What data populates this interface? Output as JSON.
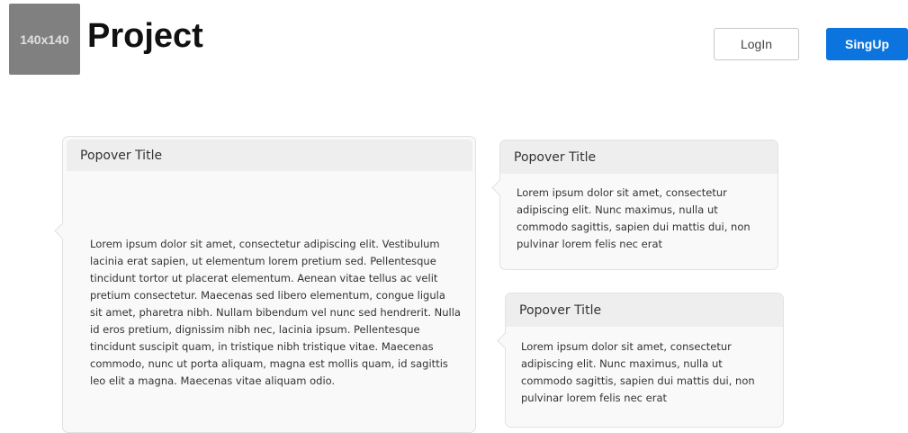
{
  "header": {
    "logo_text": "140x140",
    "title": "Project",
    "login_label": "LogIn",
    "signup_label": "SingUp"
  },
  "popovers": [
    {
      "title": "Popover Title",
      "body": "Lorem ipsum dolor sit amet, consectetur adipiscing elit. Vestibulum lacinia erat sapien, ut elementum lorem pretium sed. Pellentesque tincidunt tortor ut placerat elementum. Aenean vitae tellus ac velit pretium consectetur. Maecenas sed libero elementum, congue ligula sit amet, pharetra nibh. Nullam bibendum vel nunc sed hendrerit. Nulla id eros pretium, dignissim nibh nec, lacinia ipsum. Pellentesque tincidunt suscipit quam, in tristique nibh tristique vitae. Maecenas commodo, nunc ut porta aliquam, magna est mollis quam, id sagittis leo elit a magna. Maecenas vitae aliquam odio."
    },
    {
      "title": "Popover Title",
      "body": "Lorem ipsum dolor sit amet, consectetur adipiscing elit. Nunc maximus, nulla ut commodo sagittis, sapien dui mattis dui, non pulvinar lorem felis nec erat"
    },
    {
      "title": "Popover Title",
      "body": "Lorem ipsum dolor sit amet, consectetur adipiscing elit. Nunc maximus, nulla ut commodo sagittis, sapien dui mattis dui, non pulvinar lorem felis nec erat"
    }
  ]
}
